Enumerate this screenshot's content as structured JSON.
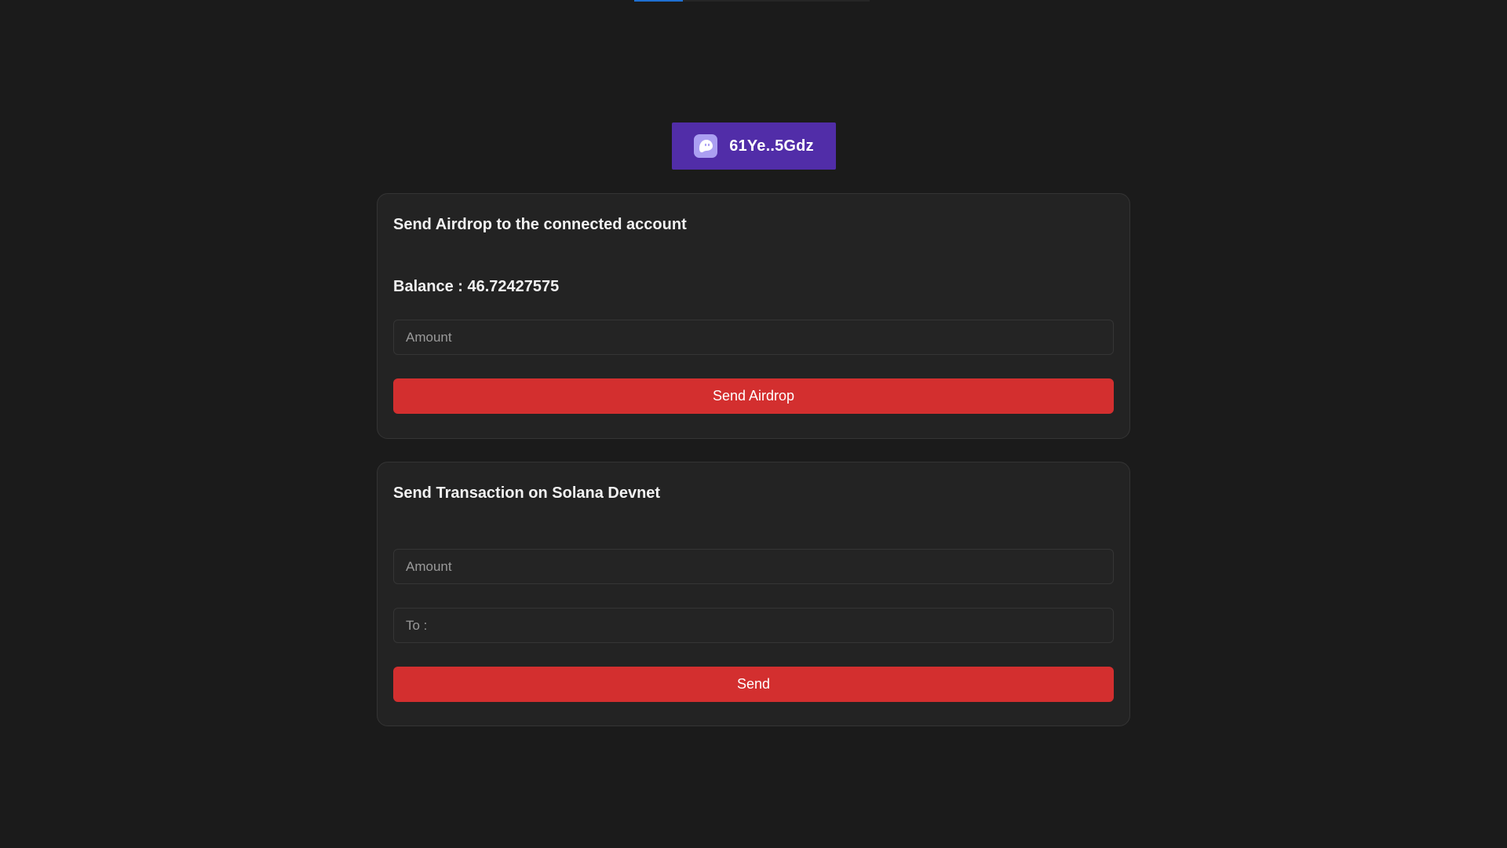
{
  "wallet": {
    "address": "61Ye..5Gdz",
    "icon": "phantom-ghost-icon",
    "color": "#512da8"
  },
  "airdrop": {
    "title": "Send Airdrop to the connected account",
    "balance": "Balance : 46.72427575",
    "amount_placeholder": "Amount",
    "button_label": "Send Airdrop"
  },
  "transaction": {
    "title": "Send Transaction on Solana Devnet",
    "amount_placeholder": "Amount",
    "to_placeholder": "To :",
    "button_label": "Send"
  },
  "colors": {
    "background": "#1b1b1b",
    "card": "#232323",
    "accent_red": "#d32f2f",
    "wallet_purple": "#512da8"
  }
}
